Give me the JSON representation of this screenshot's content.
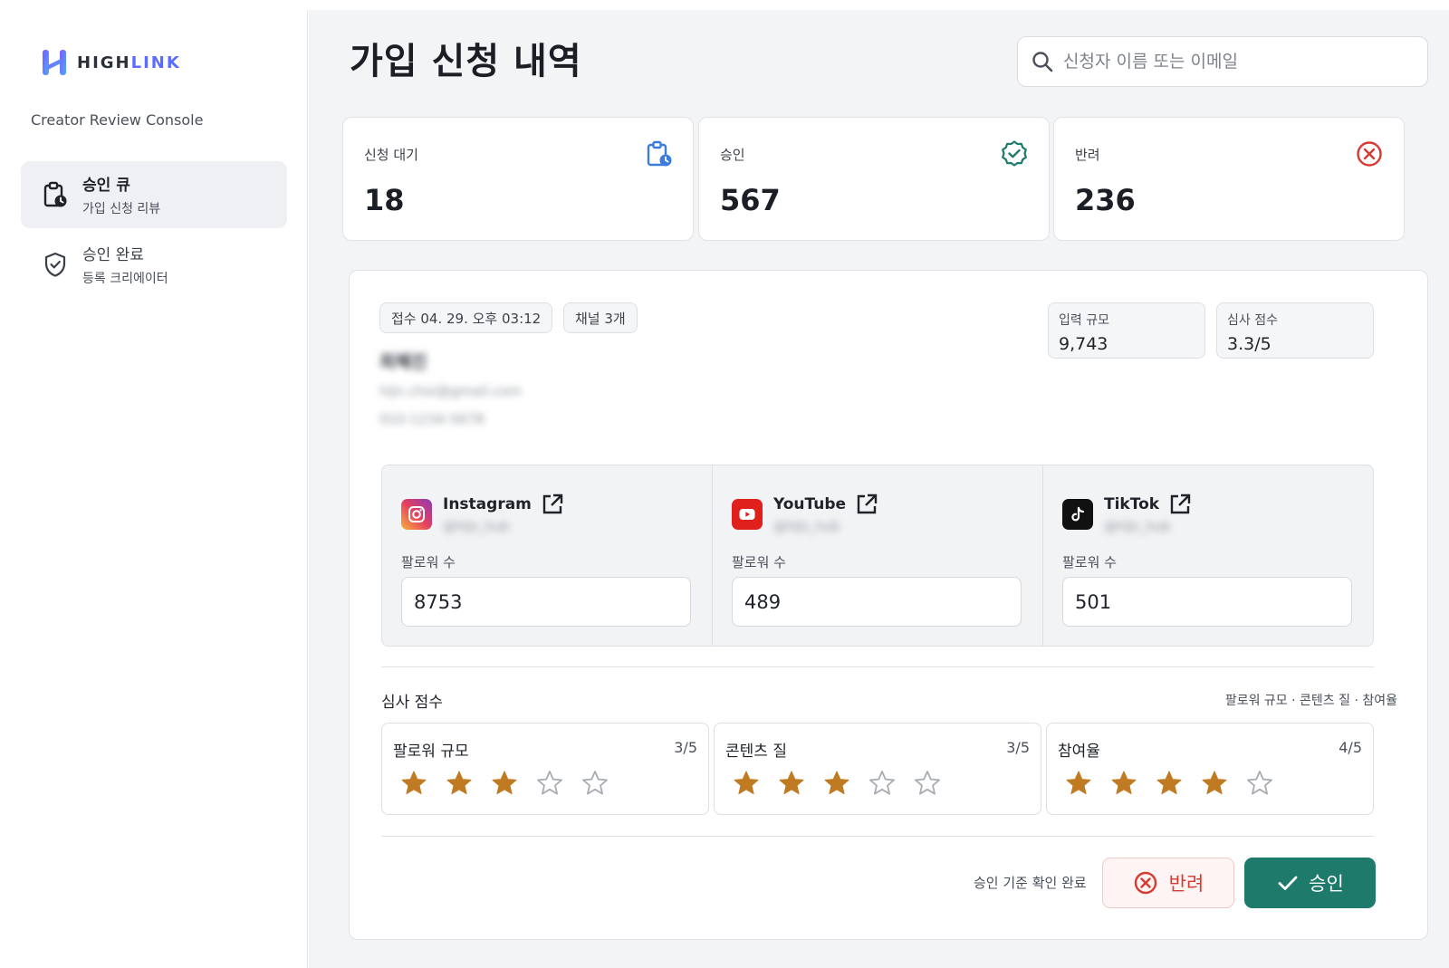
{
  "brand": {
    "logo_text_high": "HIGH",
    "logo_text_link": "LINK",
    "console_name": "Creator Review Console",
    "accent": "#5b6cff"
  },
  "sidebar": {
    "items": [
      {
        "title": "승인 큐",
        "subtitle": "가입 신청 리뷰",
        "icon": "clipboard-clock-icon",
        "active": true
      },
      {
        "title": "승인 완료",
        "subtitle": "등록 크리에이터",
        "icon": "shield-check-icon",
        "active": false
      }
    ]
  },
  "header": {
    "title": "가입 신청 내역",
    "search_placeholder": "신청자 이름 또는 이메일"
  },
  "stats": [
    {
      "label": "신청 대기",
      "value": "18",
      "icon": "clipboard-clock-icon",
      "color": "#3b7ddd"
    },
    {
      "label": "승인",
      "value": "567",
      "icon": "badge-check-icon",
      "color": "#1e7a6b"
    },
    {
      "label": "반려",
      "value": "236",
      "icon": "x-circle-icon",
      "color": "#d63a32"
    }
  ],
  "application": {
    "received_chip": "접수 04. 29. 오후 03:12",
    "channels_chip": "채널 3개",
    "applicant_name": "최혜진",
    "applicant_email": "hljn.choi@gmail.com",
    "applicant_phone": "010-1234-5678",
    "metrics": [
      {
        "label": "입력 규모",
        "value": "9,743"
      },
      {
        "label": "심사 점수",
        "value": "3.3/5"
      }
    ],
    "channels": [
      {
        "name": "Instagram",
        "handle": "@hljn_hub",
        "followers_label": "팔로워 수",
        "followers": "8753",
        "icon": "instagram-icon"
      },
      {
        "name": "YouTube",
        "handle": "@hljn_hub",
        "followers_label": "팔로워 수",
        "followers": "489",
        "icon": "youtube-icon"
      },
      {
        "name": "TikTok",
        "handle": "@hljn_hub",
        "followers_label": "팔로워 수",
        "followers": "501",
        "icon": "tiktok-icon"
      }
    ],
    "scores_title": "심사 점수",
    "scores_criteria": "팔로워 규모 · 콘텐츠 질 · 참여율",
    "scores": [
      {
        "name": "팔로워 규모",
        "value": "3/5",
        "rating": 3,
        "max": 5
      },
      {
        "name": "콘텐츠 질",
        "value": "3/5",
        "rating": 3,
        "max": 5
      },
      {
        "name": "참여율",
        "value": "4/5",
        "rating": 4,
        "max": 5
      }
    ],
    "star_color": "#c07a22",
    "confirm_text": "승인 기준 확인 완료",
    "reject_label": "반려",
    "approve_label": "승인"
  }
}
